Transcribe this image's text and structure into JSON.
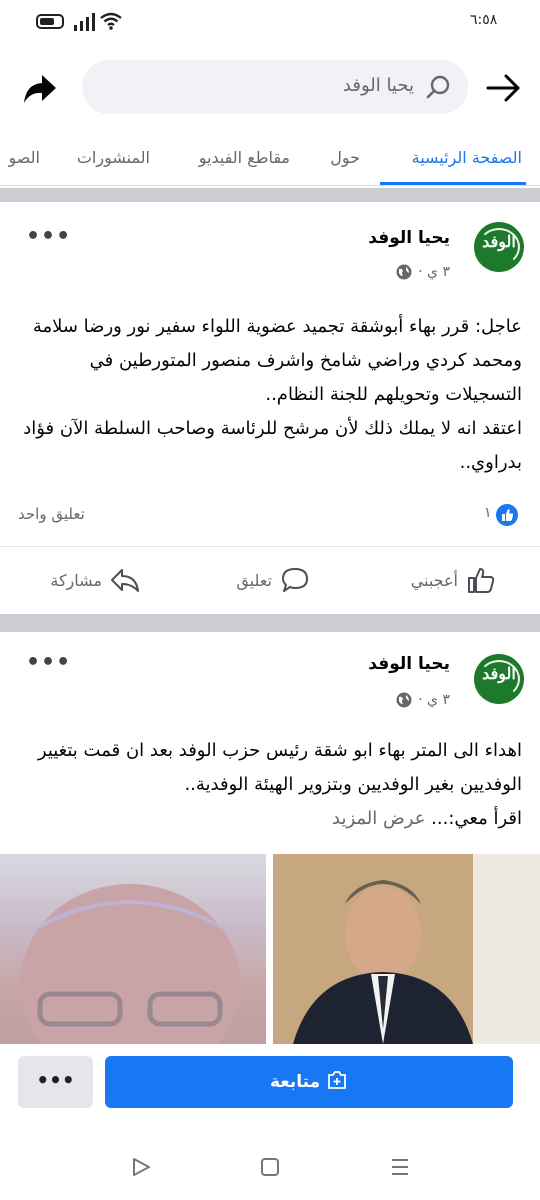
{
  "status": {
    "time": "٦:٥٨"
  },
  "search": {
    "query": "يحيا الوفد"
  },
  "tabs": [
    {
      "label": "الصفحة الرئيسية"
    },
    {
      "label": "حول"
    },
    {
      "label": "مقاطع الفيديو"
    },
    {
      "label": "المنشورات"
    },
    {
      "label": "الصو"
    }
  ],
  "posts": [
    {
      "author": "يحيا الوفد",
      "avatar_text": "الوفد",
      "time": "٣ ي ·",
      "more": "•••",
      "text": "عاجل: قرر بهاء أبوشقة تجميد عضوية اللواء سفير نور ورضا سلامة ومحمد كردي وراضي شامخ واشرف منصور المتورطين في التسجيلات وتحويلهم للجنة النظام..\nاعتقد انه لا يملك ذلك لأن مرشح للرئاسة وصاحب السلطة الآن فؤاد بدراوي..",
      "likes": "١",
      "comments": "تعليق واحد",
      "actions": {
        "like": "أعجبني",
        "comment": "تعليق",
        "share": "مشاركة"
      }
    },
    {
      "author": "يحيا الوفد",
      "avatar_text": "الوفد",
      "time": "٣ ي ·",
      "more": "•••",
      "text": "اهداء الى المتر بهاء ابو شقة رئيس حزب الوفد بعد ان قمت بتغيير الوفديين بغير الوفديين وبتزوير الهيئة الوفدية..\nاقرأ معي:...",
      "see_more": "عرض المزيد"
    }
  ],
  "follow_bar": {
    "follow_label": "متابعة",
    "more": "•••"
  },
  "colors": {
    "accent": "#1877f2",
    "avatar_bg": "#1d7a2c"
  }
}
